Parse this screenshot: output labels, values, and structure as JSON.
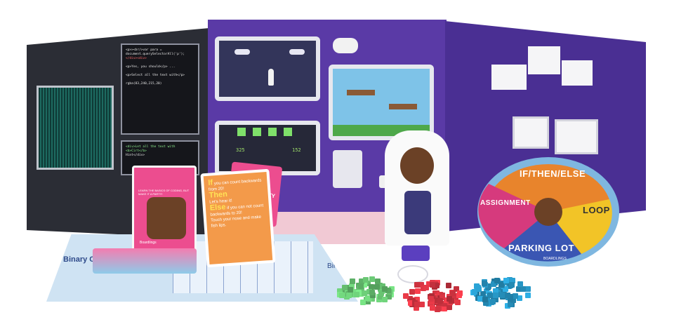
{
  "code_panel": {
    "lines": [
      "<p>><br/>var para = document.querySelectorAll('p');",
      "</div><div>",
      "<p>Yes, you should</p> ...",
      "<p>Select all the text with</p>",
      "rgba(83,240,215,20)"
    ],
    "bottom_lines": [
      "<div>Let all the text with <b>Cirt</b>",
      "Hint</div>"
    ]
  },
  "game_screen": {
    "score_left": "325",
    "score_right": "152"
  },
  "card_box": {
    "tagline": "LEARN THE BASICS OF CODING, BUT MAKE IT A PARTY!",
    "brand": "Boardlings"
  },
  "instruction_card": {
    "if_label": "If",
    "if_text": "you can count backwards from 20!",
    "then_label": "Then",
    "then_text": "Let's hear it!",
    "else_label": "Else",
    "else_text": "if you can not count backwards to 20!",
    "extra_text": "Touch your nose and make fish lips."
  },
  "back_card": {
    "fragment": "FTY"
  },
  "mat": {
    "title": "Binary Code Your Name!",
    "side_label": "Bingo"
  },
  "spinner": {
    "segments": [
      {
        "label": "IF/THEN/ELSE",
        "color": "#e8842c"
      },
      {
        "label": "LOOP",
        "color": "#f2c427"
      },
      {
        "label": "PARKING LOT",
        "color": "#3a56b3"
      },
      {
        "label": "ASSIGNMENT",
        "color": "#d63a7d"
      }
    ],
    "brand": "BOARDLINGS"
  },
  "cubes": {
    "colors": [
      "#6fd17a",
      "#e23846",
      "#2a9fd0"
    ]
  },
  "colors": {
    "panel_mid": "#5a3aa6",
    "panel_right": "#4a2f93",
    "panel_left": "#2b2d35",
    "card_pink": "#ec4d8f",
    "card_orange": "#f39a4a"
  }
}
